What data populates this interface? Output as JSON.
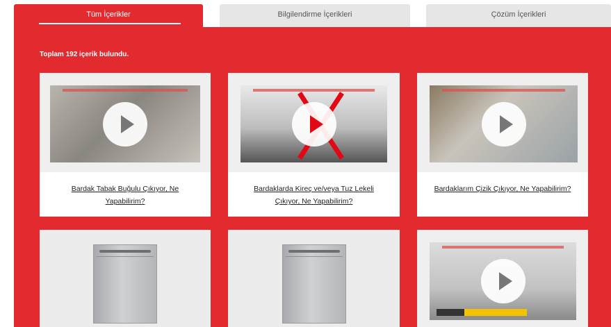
{
  "tabs": [
    {
      "label": "Tüm İçerikler",
      "active": true
    },
    {
      "label": "Bilgilendirme İçerikleri",
      "active": false
    },
    {
      "label": "Çözüm İçerikleri",
      "active": false
    }
  ],
  "summary": {
    "text": "Toplam 192 içerik bulundu."
  },
  "cards": [
    {
      "title": "Bardak Tabak Buğulu Çıkıyor, Ne Yapabilirim?",
      "thumbnail": "video",
      "play_icon": "play-icon"
    },
    {
      "title": "Bardaklarda Kireç ve/veya Tuz Lekeli Çıkıyor, Ne Yapabilirim?",
      "thumbnail": "video",
      "play_icon": "play-icon"
    },
    {
      "title": "Bardaklarım Çizik Çıkıyor, Ne Yapabilirim?",
      "thumbnail": "video",
      "play_icon": "play-icon"
    },
    {
      "title": "",
      "thumbnail": "dishwasher-image"
    },
    {
      "title": "",
      "thumbnail": "dishwasher-image"
    },
    {
      "title": "",
      "thumbnail": "video",
      "play_icon": "play-icon"
    }
  ],
  "colors": {
    "brand_red": "#e32a2e",
    "play_red": "#e30613",
    "tab_inactive": "#e6e6e6"
  }
}
